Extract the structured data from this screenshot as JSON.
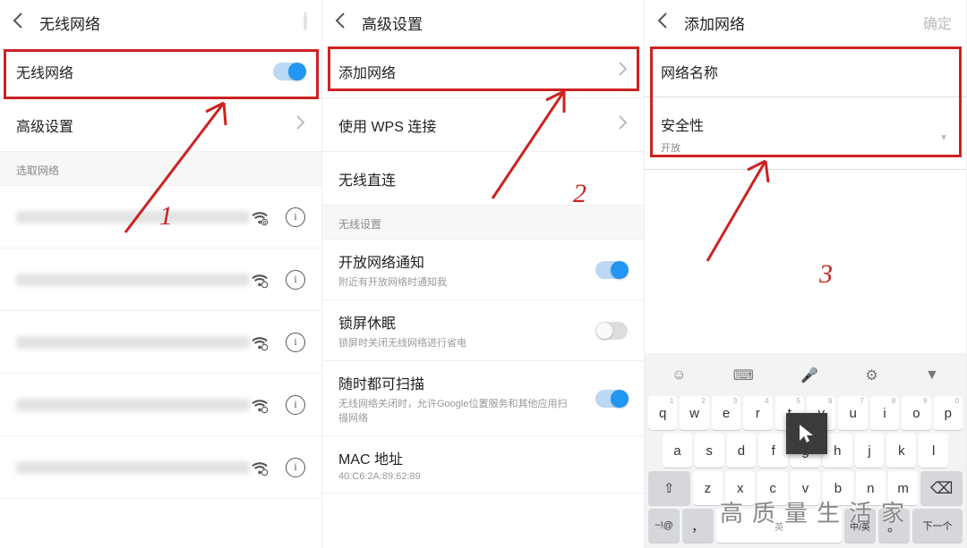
{
  "p1": {
    "title": "无线网络",
    "toggle_row": "无线网络",
    "advanced": "高级设置",
    "select_section": "选取网络",
    "step_label": "1"
  },
  "p2": {
    "title": "高级设置",
    "add_net": "添加网络",
    "wps": "使用 WPS 连接",
    "wifi_direct": "无线直连",
    "section": "无线设置",
    "open_notify": "开放网络通知",
    "open_notify_sub": "附近有开放网络时通知我",
    "sleep": "锁屏休眠",
    "sleep_sub": "锁屏时关闭无线网络进行省电",
    "scan": "随时都可扫描",
    "scan_sub": "无线网络关闭时，允许Google位置服务和其他应用扫描网络",
    "mac": "MAC 地址",
    "mac_val": "40:C6:2A:89:62:89",
    "step_label": "2"
  },
  "p3": {
    "title": "添加网络",
    "confirm": "确定",
    "name": "网络名称",
    "security": "安全性",
    "security_val": "开放",
    "step_label": "3",
    "kbd": {
      "r1": [
        "q",
        "w",
        "e",
        "r",
        "t",
        "y",
        "u",
        "i",
        "o",
        "p"
      ],
      "h1": [
        "1",
        "2",
        "3",
        "4",
        "5",
        "6",
        "7",
        "8",
        "9",
        "0"
      ],
      "r2": [
        "a",
        "s",
        "d",
        "f",
        "g",
        "h",
        "j",
        "k",
        "l"
      ],
      "r3": [
        "z",
        "x",
        "c",
        "v",
        "b",
        "n",
        "m"
      ],
      "sym": "~!@",
      "comma": "，",
      "lang_key": "中/英",
      "lang_ind": "英",
      "period": "。",
      "next": "下一个"
    }
  },
  "watermark": "高质量生活家"
}
